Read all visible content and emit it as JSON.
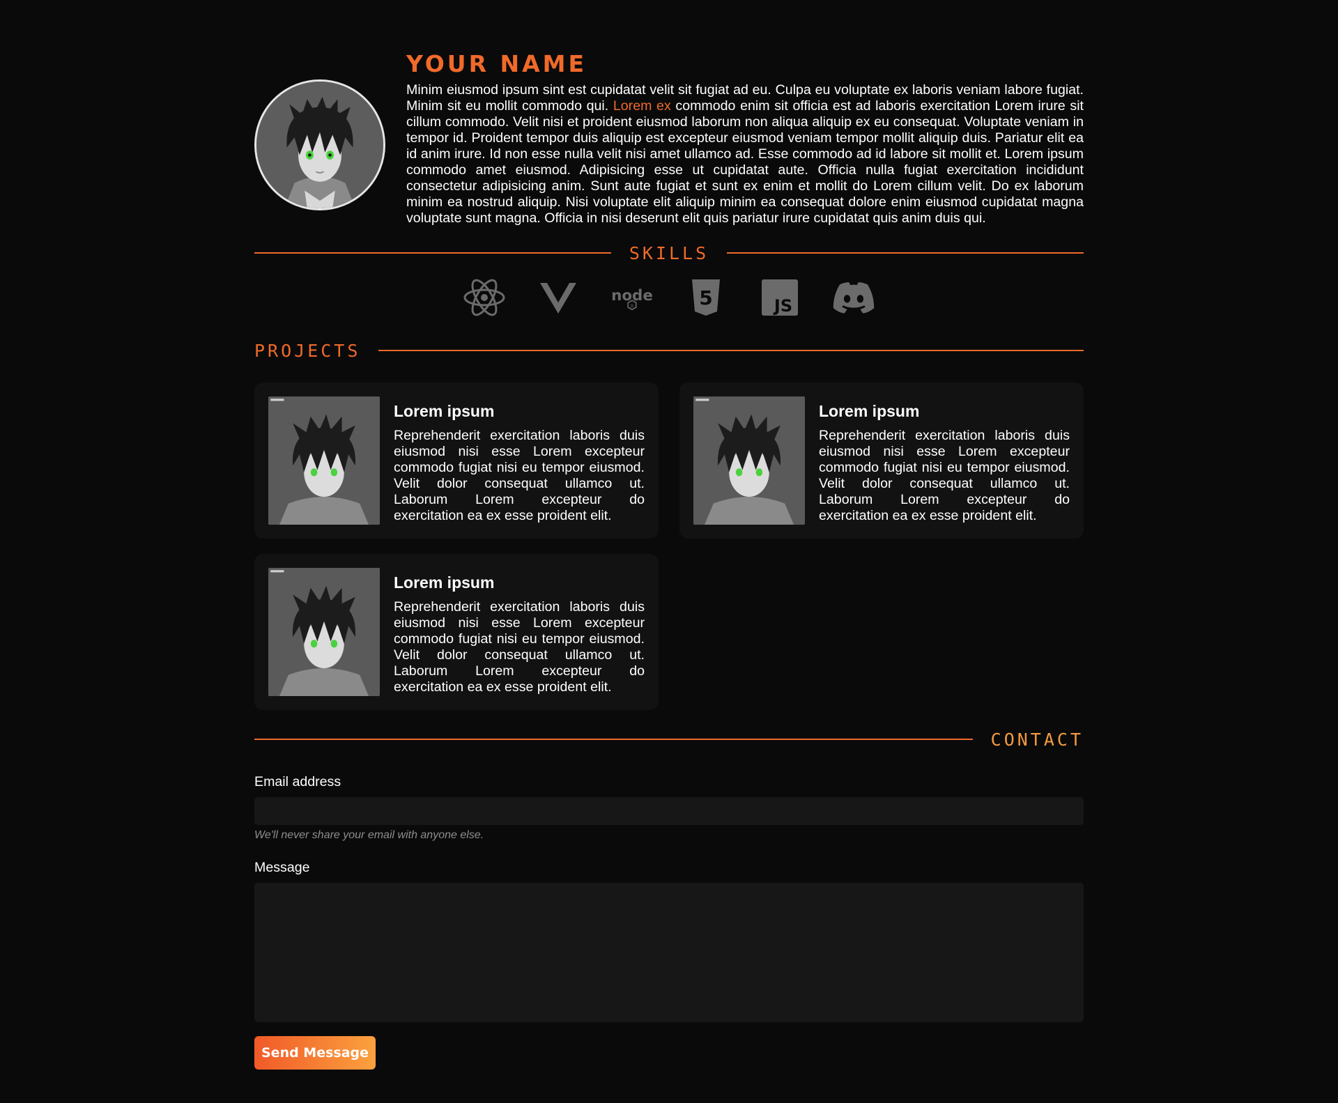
{
  "profile": {
    "name": "YOUR NAME",
    "bio_before": "Minim eiusmod ipsum sint est cupidatat velit sit fugiat ad eu. Culpa eu voluptate ex laboris veniam labore fugiat. Minim sit eu mollit commodo qui. ",
    "bio_link": "Lorem ex",
    "bio_after": " commodo enim sit officia est ad laboris exercitation Lorem irure sit cillum commodo. Velit nisi et proident eiusmod laborum non aliqua aliquip ex eu consequat. Voluptate veniam in tempor id. Proident tempor duis aliquip est excepteur eiusmod veniam tempor mollit aliquip duis. Pariatur elit ea id anim irure. Id non esse nulla velit nisi amet ullamco ad. Esse commodo ad id labore sit mollit et. Lorem ipsum commodo amet eiusmod. Adipisicing esse ut cupidatat aute. Officia nulla fugiat exercitation incididunt consectetur adipisicing anim. Sunt aute fugiat et sunt ex enim et mollit do Lorem cillum velit. Do ex laborum minim ea nostrud aliquip. Nisi voluptate elit aliquip minim ea consequat dolore enim eiusmod cupidatat magna voluptate sunt magna. Officia in nisi deserunt elit quis pariatur irure cupidatat quis anim duis qui."
  },
  "sections": {
    "skills": "SKILLS",
    "projects": "PROJECTS",
    "contact": "CONTACT"
  },
  "skills": [
    "react-icon",
    "vue-icon",
    "nodejs-icon",
    "html5-icon",
    "javascript-icon",
    "discord-icon"
  ],
  "projects": [
    {
      "title": "Lorem ipsum",
      "text": "Reprehenderit exercitation laboris duis eiusmod nisi esse Lorem excepteur commodo fugiat nisi eu tempor eiusmod. Velit dolor consequat ullamco ut. Laborum Lorem excepteur do exercitation ea ex esse proident elit."
    },
    {
      "title": "Lorem ipsum",
      "text": "Reprehenderit exercitation laboris duis eiusmod nisi esse Lorem excepteur commodo fugiat nisi eu tempor eiusmod. Velit dolor consequat ullamco ut. Laborum Lorem excepteur do exercitation ea ex esse proident elit."
    },
    {
      "title": "Lorem ipsum",
      "text": "Reprehenderit exercitation laboris duis eiusmod nisi esse Lorem excepteur commodo fugiat nisi eu tempor eiusmod. Velit dolor consequat ullamco ut. Laborum Lorem excepteur do exercitation ea ex esse proident elit."
    }
  ],
  "contact": {
    "email_label": "Email address",
    "email_value": "",
    "email_hint": "We'll never share your email with anyone else.",
    "message_label": "Message",
    "message_value": "",
    "send_label": "Send Message"
  },
  "colors": {
    "accent": "#f06a2a",
    "accent_light": "#fba13e",
    "background": "#0a0a0b",
    "card": "#121212",
    "input": "#171717"
  }
}
